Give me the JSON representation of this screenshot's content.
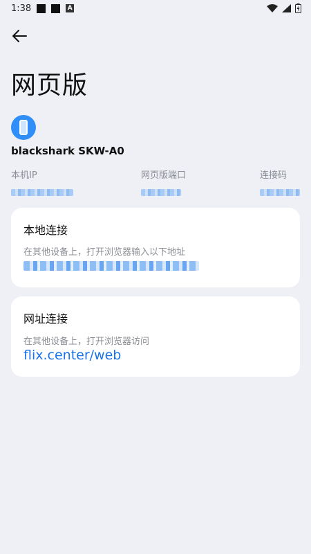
{
  "status_bar": {
    "time": "1:38",
    "icons": [
      "notification-square-icon",
      "notification-square-icon",
      "a-badge-icon",
      "wifi-icon",
      "cellular-icon",
      "battery-charging-icon"
    ],
    "badge_letter": "A"
  },
  "header": {
    "back_icon": "arrow-left-icon",
    "title": "网页版"
  },
  "device": {
    "icon": "phone-icon",
    "accent_color": "#2f8ef7",
    "name": "blackshark SKW-A0"
  },
  "info": {
    "ip_label": "本机IP",
    "port_label": "网页版端口",
    "code_label": "连接码"
  },
  "local_card": {
    "title": "本地连接",
    "description": "在其他设备上，打开浏览器输入以下地址"
  },
  "url_card": {
    "title": "网址连接",
    "description": "在其他设备上，打开浏览器访问",
    "link": "flix.center/web",
    "link_color": "#1a73e8"
  }
}
